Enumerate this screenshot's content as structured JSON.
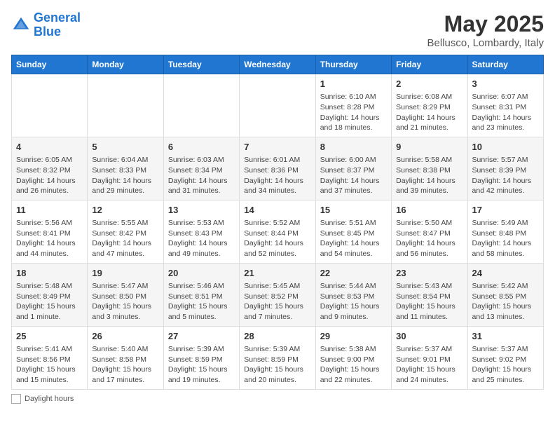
{
  "header": {
    "logo_line1": "General",
    "logo_line2": "Blue",
    "main_title": "May 2025",
    "subtitle": "Bellusco, Lombardy, Italy"
  },
  "days_of_week": [
    "Sunday",
    "Monday",
    "Tuesday",
    "Wednesday",
    "Thursday",
    "Friday",
    "Saturday"
  ],
  "weeks": [
    [
      {
        "num": "",
        "info": ""
      },
      {
        "num": "",
        "info": ""
      },
      {
        "num": "",
        "info": ""
      },
      {
        "num": "",
        "info": ""
      },
      {
        "num": "1",
        "info": "Sunrise: 6:10 AM\nSunset: 8:28 PM\nDaylight: 14 hours\nand 18 minutes."
      },
      {
        "num": "2",
        "info": "Sunrise: 6:08 AM\nSunset: 8:29 PM\nDaylight: 14 hours\nand 21 minutes."
      },
      {
        "num": "3",
        "info": "Sunrise: 6:07 AM\nSunset: 8:31 PM\nDaylight: 14 hours\nand 23 minutes."
      }
    ],
    [
      {
        "num": "4",
        "info": "Sunrise: 6:05 AM\nSunset: 8:32 PM\nDaylight: 14 hours\nand 26 minutes."
      },
      {
        "num": "5",
        "info": "Sunrise: 6:04 AM\nSunset: 8:33 PM\nDaylight: 14 hours\nand 29 minutes."
      },
      {
        "num": "6",
        "info": "Sunrise: 6:03 AM\nSunset: 8:34 PM\nDaylight: 14 hours\nand 31 minutes."
      },
      {
        "num": "7",
        "info": "Sunrise: 6:01 AM\nSunset: 8:36 PM\nDaylight: 14 hours\nand 34 minutes."
      },
      {
        "num": "8",
        "info": "Sunrise: 6:00 AM\nSunset: 8:37 PM\nDaylight: 14 hours\nand 37 minutes."
      },
      {
        "num": "9",
        "info": "Sunrise: 5:58 AM\nSunset: 8:38 PM\nDaylight: 14 hours\nand 39 minutes."
      },
      {
        "num": "10",
        "info": "Sunrise: 5:57 AM\nSunset: 8:39 PM\nDaylight: 14 hours\nand 42 minutes."
      }
    ],
    [
      {
        "num": "11",
        "info": "Sunrise: 5:56 AM\nSunset: 8:41 PM\nDaylight: 14 hours\nand 44 minutes."
      },
      {
        "num": "12",
        "info": "Sunrise: 5:55 AM\nSunset: 8:42 PM\nDaylight: 14 hours\nand 47 minutes."
      },
      {
        "num": "13",
        "info": "Sunrise: 5:53 AM\nSunset: 8:43 PM\nDaylight: 14 hours\nand 49 minutes."
      },
      {
        "num": "14",
        "info": "Sunrise: 5:52 AM\nSunset: 8:44 PM\nDaylight: 14 hours\nand 52 minutes."
      },
      {
        "num": "15",
        "info": "Sunrise: 5:51 AM\nSunset: 8:45 PM\nDaylight: 14 hours\nand 54 minutes."
      },
      {
        "num": "16",
        "info": "Sunrise: 5:50 AM\nSunset: 8:47 PM\nDaylight: 14 hours\nand 56 minutes."
      },
      {
        "num": "17",
        "info": "Sunrise: 5:49 AM\nSunset: 8:48 PM\nDaylight: 14 hours\nand 58 minutes."
      }
    ],
    [
      {
        "num": "18",
        "info": "Sunrise: 5:48 AM\nSunset: 8:49 PM\nDaylight: 15 hours\nand 1 minute."
      },
      {
        "num": "19",
        "info": "Sunrise: 5:47 AM\nSunset: 8:50 PM\nDaylight: 15 hours\nand 3 minutes."
      },
      {
        "num": "20",
        "info": "Sunrise: 5:46 AM\nSunset: 8:51 PM\nDaylight: 15 hours\nand 5 minutes."
      },
      {
        "num": "21",
        "info": "Sunrise: 5:45 AM\nSunset: 8:52 PM\nDaylight: 15 hours\nand 7 minutes."
      },
      {
        "num": "22",
        "info": "Sunrise: 5:44 AM\nSunset: 8:53 PM\nDaylight: 15 hours\nand 9 minutes."
      },
      {
        "num": "23",
        "info": "Sunrise: 5:43 AM\nSunset: 8:54 PM\nDaylight: 15 hours\nand 11 minutes."
      },
      {
        "num": "24",
        "info": "Sunrise: 5:42 AM\nSunset: 8:55 PM\nDaylight: 15 hours\nand 13 minutes."
      }
    ],
    [
      {
        "num": "25",
        "info": "Sunrise: 5:41 AM\nSunset: 8:56 PM\nDaylight: 15 hours\nand 15 minutes."
      },
      {
        "num": "26",
        "info": "Sunrise: 5:40 AM\nSunset: 8:58 PM\nDaylight: 15 hours\nand 17 minutes."
      },
      {
        "num": "27",
        "info": "Sunrise: 5:39 AM\nSunset: 8:59 PM\nDaylight: 15 hours\nand 19 minutes."
      },
      {
        "num": "28",
        "info": "Sunrise: 5:39 AM\nSunset: 8:59 PM\nDaylight: 15 hours\nand 20 minutes."
      },
      {
        "num": "29",
        "info": "Sunrise: 5:38 AM\nSunset: 9:00 PM\nDaylight: 15 hours\nand 22 minutes."
      },
      {
        "num": "30",
        "info": "Sunrise: 5:37 AM\nSunset: 9:01 PM\nDaylight: 15 hours\nand 24 minutes."
      },
      {
        "num": "31",
        "info": "Sunrise: 5:37 AM\nSunset: 9:02 PM\nDaylight: 15 hours\nand 25 minutes."
      }
    ]
  ],
  "footer": {
    "note": "Daylight hours"
  }
}
